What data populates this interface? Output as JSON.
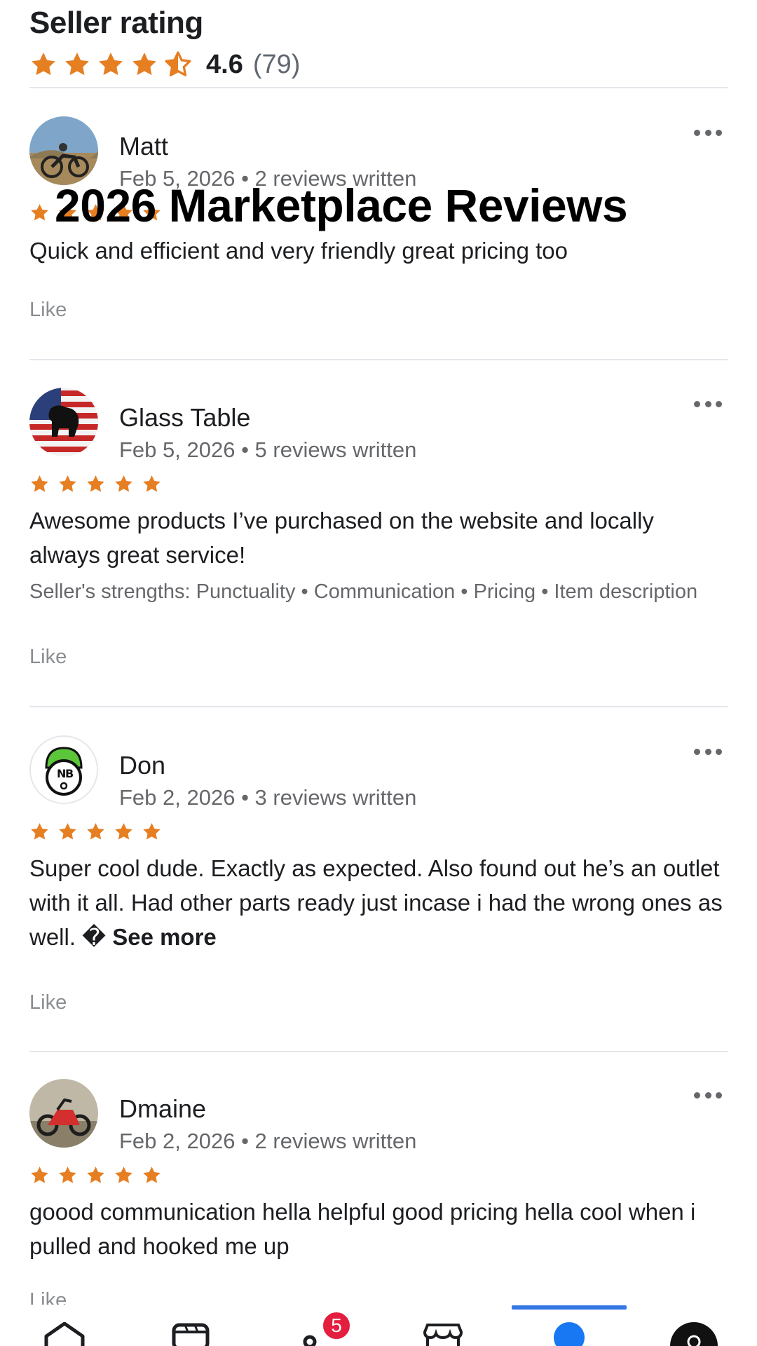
{
  "header": {
    "title": "Seller rating",
    "rating_value": "4.6",
    "rating_count": "(79)",
    "rating_stars": 4.5
  },
  "overlay": {
    "title": "2026 Marketplace Reviews"
  },
  "colors": {
    "star": "#e67e22",
    "text": "#1c1e21",
    "muted": "#65676b",
    "accent": "#3578e5",
    "badge": "#e41e3f"
  },
  "reviews": [
    {
      "name": "Matt",
      "meta": "Feb 5, 2026 • 2 reviews written",
      "stars": 5,
      "text": "Quick and efficient and very friendly great pricing too",
      "like": "Like"
    },
    {
      "name": "Glass Table",
      "meta": "Feb 5, 2026 • 5 reviews written",
      "stars": 5,
      "text": "Awesome products I’ve purchased on the website and locally always great service!",
      "strengths": "Seller's strengths: Punctuality • Communication • Pricing • Item description",
      "like": "Like"
    },
    {
      "name": "Don",
      "meta": "Feb 2, 2026 • 3 reviews written",
      "stars": 5,
      "text": "Super cool dude. Exactly as expected. Also found out he’s an outlet with it all. Had other parts ready just incase i had the wrong ones as well. �",
      "see_more": "See more",
      "like": "Like"
    },
    {
      "name": "Dmaine",
      "meta": "Feb 2, 2026 • 2 reviews written",
      "stars": 5,
      "text": "goood communication hella helpful good pricing hella cool when i pulled and hooked me up",
      "like": "Like"
    }
  ],
  "nav": {
    "items": [
      "home-icon",
      "video-icon",
      "notifications-icon",
      "marketplace-icon",
      "profile-icon",
      "menu-avatar-icon"
    ],
    "notification_badge": "5",
    "active_index": 4
  }
}
